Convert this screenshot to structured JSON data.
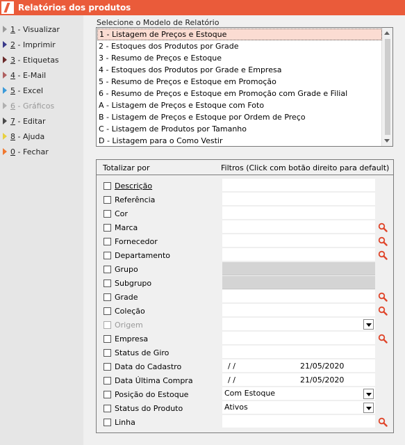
{
  "window": {
    "title": "Relatórios dos produtos"
  },
  "sidebar": {
    "items": [
      {
        "key": "1",
        "label": " - Visualizar",
        "color": "#9a9a9a",
        "disabled": false
      },
      {
        "key": "2",
        "label": " - Imprimir",
        "color": "#3a3a8a",
        "disabled": false
      },
      {
        "key": "3",
        "label": " - Etiquetas",
        "color": "#6a2a2a",
        "disabled": false
      },
      {
        "key": "4",
        "label": " - E-Mail",
        "color": "#b06060",
        "disabled": false
      },
      {
        "key": "5",
        "label": " - Excel",
        "color": "#3b9ad9",
        "disabled": false
      },
      {
        "key": "6",
        "label": " - Gráficos",
        "color": "#b0b0b0",
        "disabled": true
      },
      {
        "key": "7",
        "label": " - Editar",
        "color": "#4a4a4a",
        "disabled": false
      },
      {
        "key": "8",
        "label": " - Ajuda",
        "color": "#e8d040",
        "disabled": false
      },
      {
        "key": "0",
        "label": " - Fechar",
        "color": "#f07830",
        "disabled": false
      }
    ]
  },
  "model_select": {
    "label": "Selecione o Modelo de Relatório",
    "selected_index": 0,
    "options": [
      "1 - Listagem de Preços e Estoque",
      "2 - Estoques dos Produtos por Grade",
      "3 - Resumo de Preços e Estoque",
      "4 - Estoques dos Produtos por Grade e Empresa",
      "5 - Resumo de Preços e Estoque em Promoção",
      "6 - Resumo de Preços e Estoque em Promoção com Grade e Filial",
      "A - Listagem de Preços e Estoque com Foto",
      "B - Listagem de Preços e Estoque por Ordem de Preço",
      "C - Listagem de Produtos por Tamanho",
      "D - Listagem para o Como Vestir"
    ]
  },
  "filters": {
    "header_left": "Totalizar por",
    "header_right": "Filtros (Click com botão direito para default)",
    "rows": [
      {
        "label": "Descrição",
        "underline": true,
        "field": "white",
        "value": "",
        "search": false,
        "dropdown": false,
        "disabled": false
      },
      {
        "label": "Referência",
        "field": "white",
        "value": "",
        "search": false,
        "dropdown": false,
        "disabled": false
      },
      {
        "label": "Cor",
        "field": "white",
        "value": "",
        "search": false,
        "dropdown": false,
        "disabled": false
      },
      {
        "label": "Marca",
        "field": "white",
        "value": "",
        "search": true,
        "dropdown": false,
        "disabled": false
      },
      {
        "label": "Fornecedor",
        "field": "white",
        "value": "",
        "search": true,
        "dropdown": false,
        "disabled": false
      },
      {
        "label": "Departamento",
        "field": "white",
        "value": "",
        "search": true,
        "dropdown": false,
        "disabled": false
      },
      {
        "label": "Grupo",
        "field": "grey",
        "value": "",
        "search": false,
        "dropdown": false,
        "disabled": false
      },
      {
        "label": "Subgrupo",
        "field": "grey",
        "value": "",
        "search": false,
        "dropdown": false,
        "disabled": false
      },
      {
        "label": "Grade",
        "field": "white",
        "value": "",
        "search": true,
        "dropdown": false,
        "disabled": false
      },
      {
        "label": "Coleção",
        "field": "white",
        "value": "",
        "search": true,
        "dropdown": false,
        "disabled": false
      },
      {
        "label": "Origem",
        "field": "white",
        "value": "",
        "search": false,
        "dropdown": true,
        "disabled": true
      },
      {
        "label": "Empresa",
        "field": "white",
        "value": "",
        "search": true,
        "dropdown": false,
        "disabled": false
      },
      {
        "label": "Status de Giro",
        "field": "white",
        "value": "",
        "search": false,
        "dropdown": false,
        "disabled": false
      },
      {
        "label": "Data do Cadastro",
        "field": "date",
        "date_from": " /  /",
        "date_to": "21/05/2020",
        "search": false,
        "dropdown": false,
        "disabled": false
      },
      {
        "label": "Data Última Compra",
        "field": "date",
        "date_from": " /  /",
        "date_to": "21/05/2020",
        "search": false,
        "dropdown": false,
        "disabled": false
      },
      {
        "label": "Posição do Estoque",
        "field": "white",
        "value": "Com Estoque",
        "search": false,
        "dropdown": true,
        "disabled": false
      },
      {
        "label": "Status do Produto",
        "field": "white",
        "value": "Ativos",
        "search": false,
        "dropdown": true,
        "disabled": false
      },
      {
        "label": "Linha",
        "field": "white",
        "value": "",
        "search": true,
        "dropdown": false,
        "disabled": false
      }
    ]
  },
  "icons": {
    "search": "magnifier-icon",
    "search_color": "#e0452a"
  }
}
